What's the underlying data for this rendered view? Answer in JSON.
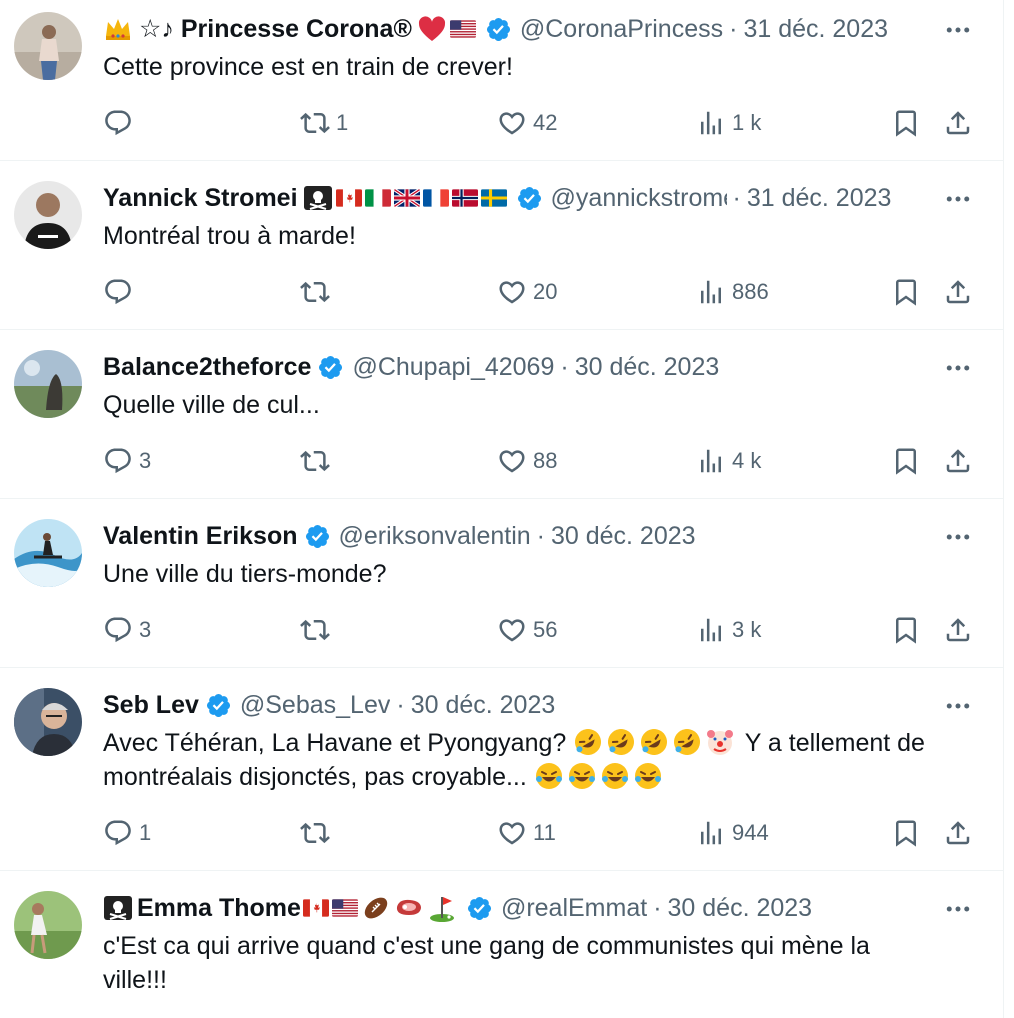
{
  "colors": {
    "text": "#0f1419",
    "muted": "#536471",
    "verified": "#1d9bf0",
    "divider": "#eff3f4"
  },
  "tweets": [
    {
      "name": "☆♪ Princesse Corona®",
      "handle": "@CoronaPrincess",
      "separator": "·",
      "date": "31 déc. 2023",
      "text": "Cette province est en train de crever!",
      "counts": {
        "replies": "",
        "reposts": "1",
        "likes": "42",
        "views": "1 k"
      }
    },
    {
      "name": "Yannick Stromei",
      "handle": "@yannickstromei",
      "separator": "·",
      "date": "31 déc. 2023",
      "text": "Montréal trou à marde!",
      "counts": {
        "replies": "",
        "reposts": "",
        "likes": "20",
        "views": "886"
      }
    },
    {
      "name": "Balance2theforce",
      "handle": "@Chupapi_42069",
      "separator": "·",
      "date": "30 déc. 2023",
      "text": "Quelle ville de cul...",
      "counts": {
        "replies": "3",
        "reposts": "",
        "likes": "88",
        "views": "4 k"
      }
    },
    {
      "name": "Valentin Erikson",
      "handle": "@eriksonvalentin",
      "separator": "·",
      "date": "30 déc. 2023",
      "text": "Une ville du tiers-monde?",
      "counts": {
        "replies": "3",
        "reposts": "",
        "likes": "56",
        "views": "3 k"
      }
    },
    {
      "name": "Seb Lev",
      "handle": "@Sebas_Lev",
      "separator": "·",
      "date": "30 déc. 2023",
      "text_line1": "Avec Téhéran, La Havane et Pyongyang?",
      "text_line1_end": "Y a tellement de",
      "text_line2": "montréalais disjonctés, pas croyable...",
      "counts": {
        "replies": "1",
        "reposts": "",
        "likes": "11",
        "views": "944"
      }
    },
    {
      "name": "Emma Thome",
      "handle": "@realEmmat",
      "separator": "·",
      "date": "30 déc. 2023",
      "text": "c'Est ca qui arrive quand c'est une gang de communistes qui mène la ville!!!"
    }
  ]
}
